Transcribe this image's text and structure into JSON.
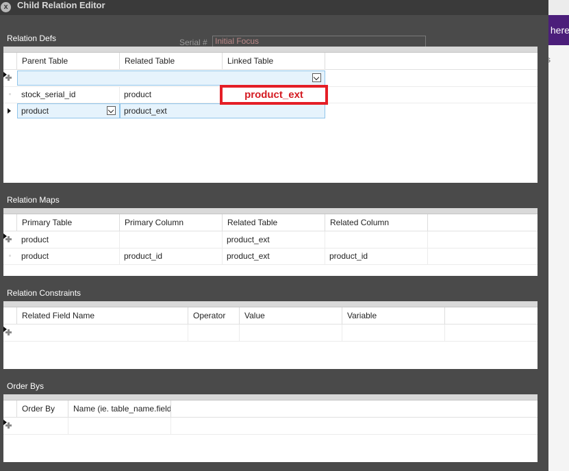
{
  "background": {
    "purple_text": "here",
    "serial_label": "Serial #",
    "initial_focus": "Initial Focus",
    "as_text": "As"
  },
  "window": {
    "title": "Child Relation Editor",
    "close_glyph": "x"
  },
  "relation_defs": {
    "label": "Relation Defs",
    "columns": [
      "Parent Table",
      "Related Table",
      "Linked Table"
    ],
    "rows": [
      {
        "parent": "stock_serial_id",
        "related": "product",
        "linked": ""
      },
      {
        "parent": "product",
        "related": "product_ext",
        "linked": ""
      }
    ],
    "annotation": "product_ext"
  },
  "relation_maps": {
    "label": "Relation Maps",
    "columns": [
      "Primary Table",
      "Primary Column",
      "Related Table",
      "Related Column"
    ],
    "rows": [
      {
        "primary_table": "product",
        "primary_column": "",
        "related_table": "product_ext",
        "related_column": ""
      },
      {
        "primary_table": "product",
        "primary_column": "product_id",
        "related_table": "product_ext",
        "related_column": "product_id"
      }
    ]
  },
  "relation_constraints": {
    "label": "Relation Constraints",
    "columns": [
      "Related Field Name",
      "Operator",
      "Value",
      "Variable"
    ]
  },
  "order_bys": {
    "label": "Order Bys",
    "columns": [
      "Order By",
      "Name (ie. table_name.field"
    ]
  },
  "colors": {
    "highlight": "#e41e26",
    "selection": "#e6f3fc"
  }
}
